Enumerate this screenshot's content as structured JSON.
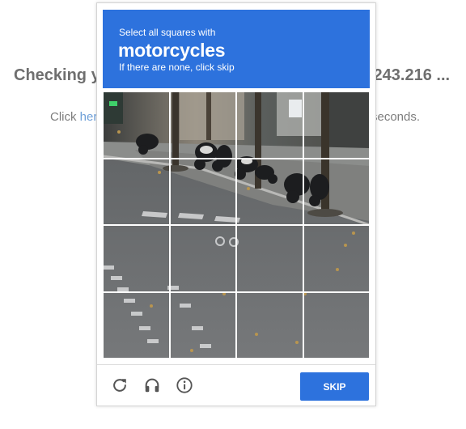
{
  "background": {
    "heading_left": "Checking yo",
    "heading_right": ".243.216 ...",
    "text_prefix": "Click ",
    "text_link": "her",
    "text_right": "seconds."
  },
  "captcha": {
    "instruction": "Select all squares with",
    "target": "motorcycles",
    "hint": "If there are none, click skip",
    "accent_color": "#2d72dd",
    "grid_size": "4x4",
    "tiles": [
      "",
      "",
      "",
      "",
      "",
      "",
      "",
      "",
      "",
      "",
      "",
      "",
      "",
      "",
      "",
      ""
    ],
    "footer": {
      "reload_icon": "reload-icon",
      "audio_icon": "headphones-icon",
      "info_icon": "info-icon",
      "skip_label": "SKIP"
    }
  }
}
